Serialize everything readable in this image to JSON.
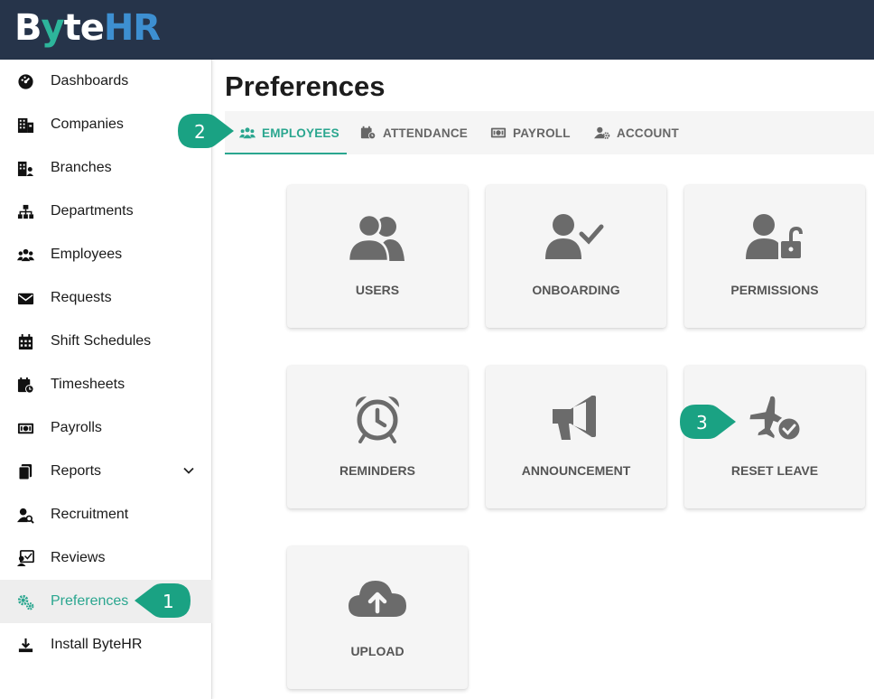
{
  "brand": {
    "logo_part1": "B",
    "logo_part2": "y",
    "logo_part3": "te",
    "logo_part4": "HR"
  },
  "sidebar": {
    "items": [
      {
        "label": "Dashboards",
        "icon": "dashboard-icon"
      },
      {
        "label": "Companies",
        "icon": "companies-icon"
      },
      {
        "label": "Branches",
        "icon": "branches-icon"
      },
      {
        "label": "Departments",
        "icon": "departments-icon"
      },
      {
        "label": "Employees",
        "icon": "employees-icon"
      },
      {
        "label": "Requests",
        "icon": "requests-icon"
      },
      {
        "label": "Shift Schedules",
        "icon": "calendar-icon"
      },
      {
        "label": "Timesheets",
        "icon": "timesheet-icon"
      },
      {
        "label": "Payrolls",
        "icon": "payroll-icon"
      },
      {
        "label": "Reports",
        "icon": "reports-icon"
      },
      {
        "label": "Recruitment",
        "icon": "recruitment-icon"
      },
      {
        "label": "Reviews",
        "icon": "reviews-icon"
      },
      {
        "label": "Preferences",
        "icon": "gears-icon"
      },
      {
        "label": "Install ByteHR",
        "icon": "download-icon"
      }
    ],
    "active": "Preferences"
  },
  "main": {
    "title": "Preferences",
    "tabs": [
      {
        "label": "EMPLOYEES",
        "active": true
      },
      {
        "label": "ATTENDANCE",
        "active": false
      },
      {
        "label": "PAYROLL",
        "active": false
      },
      {
        "label": "ACCOUNT",
        "active": false
      }
    ],
    "cards": [
      {
        "label": "USERS",
        "icon": "users-icon"
      },
      {
        "label": "ONBOARDING",
        "icon": "user-check-icon"
      },
      {
        "label": "PERMISSIONS",
        "icon": "user-lock-icon"
      },
      {
        "label": "REMINDERS",
        "icon": "alarm-clock-icon"
      },
      {
        "label": "ANNOUNCEMENT",
        "icon": "megaphone-icon"
      },
      {
        "label": "RESET LEAVE",
        "icon": "plane-check-icon"
      },
      {
        "label": "UPLOAD",
        "icon": "cloud-upload-icon"
      }
    ]
  },
  "callouts": [
    "1",
    "2",
    "3"
  ],
  "colors": {
    "accent": "#2aa68f",
    "topbar": "#26344a",
    "callout": "#1aa283",
    "icon_gray": "#6b6b6b"
  }
}
